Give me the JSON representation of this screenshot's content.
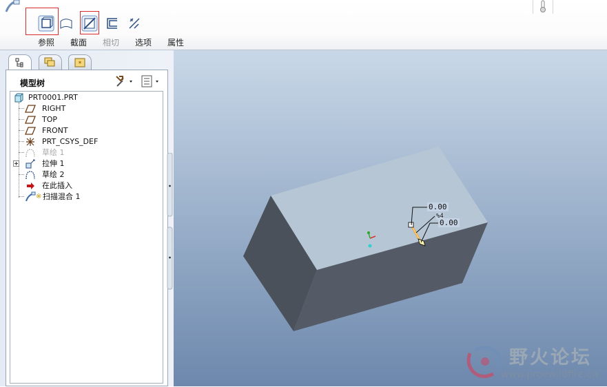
{
  "dashboard": {
    "tabs": [
      {
        "label": "参照",
        "enabled": true
      },
      {
        "label": "截面",
        "enabled": true
      },
      {
        "label": "相切",
        "enabled": false
      },
      {
        "label": "选项",
        "enabled": true
      },
      {
        "label": "属性",
        "enabled": true
      }
    ],
    "tools": [
      "solid-icon",
      "surface-icon",
      "sketch-section-icon",
      "thin-icon",
      "remove-material-icon"
    ],
    "highlight_color": "#d92b2b"
  },
  "model_tree": {
    "title": "模型树",
    "nodes": [
      {
        "label": "PRT0001.PRT",
        "icon": "part-icon"
      },
      {
        "label": "RIGHT",
        "icon": "datum-plane-icon"
      },
      {
        "label": "TOP",
        "icon": "datum-plane-icon"
      },
      {
        "label": "FRONT",
        "icon": "datum-plane-icon"
      },
      {
        "label": "PRT_CSYS_DEF",
        "icon": "csys-icon"
      },
      {
        "label": "草绘 1",
        "icon": "sketch-icon",
        "dim": true
      },
      {
        "label": "拉伸 1",
        "icon": "extrude-icon",
        "expandable": true
      },
      {
        "label": "草绘 2",
        "icon": "sketch-icon"
      },
      {
        "label": "在此插入",
        "icon": "insert-arrow-icon"
      },
      {
        "label": "扫描混合 1",
        "icon": "swept-blend-icon"
      }
    ]
  },
  "viewport": {
    "dimensions": [
      "0.00",
      "0.00"
    ],
    "dim_marker": "%4"
  },
  "watermark": {
    "text": "野火论坛",
    "url": "www.proewildfire.cn"
  }
}
